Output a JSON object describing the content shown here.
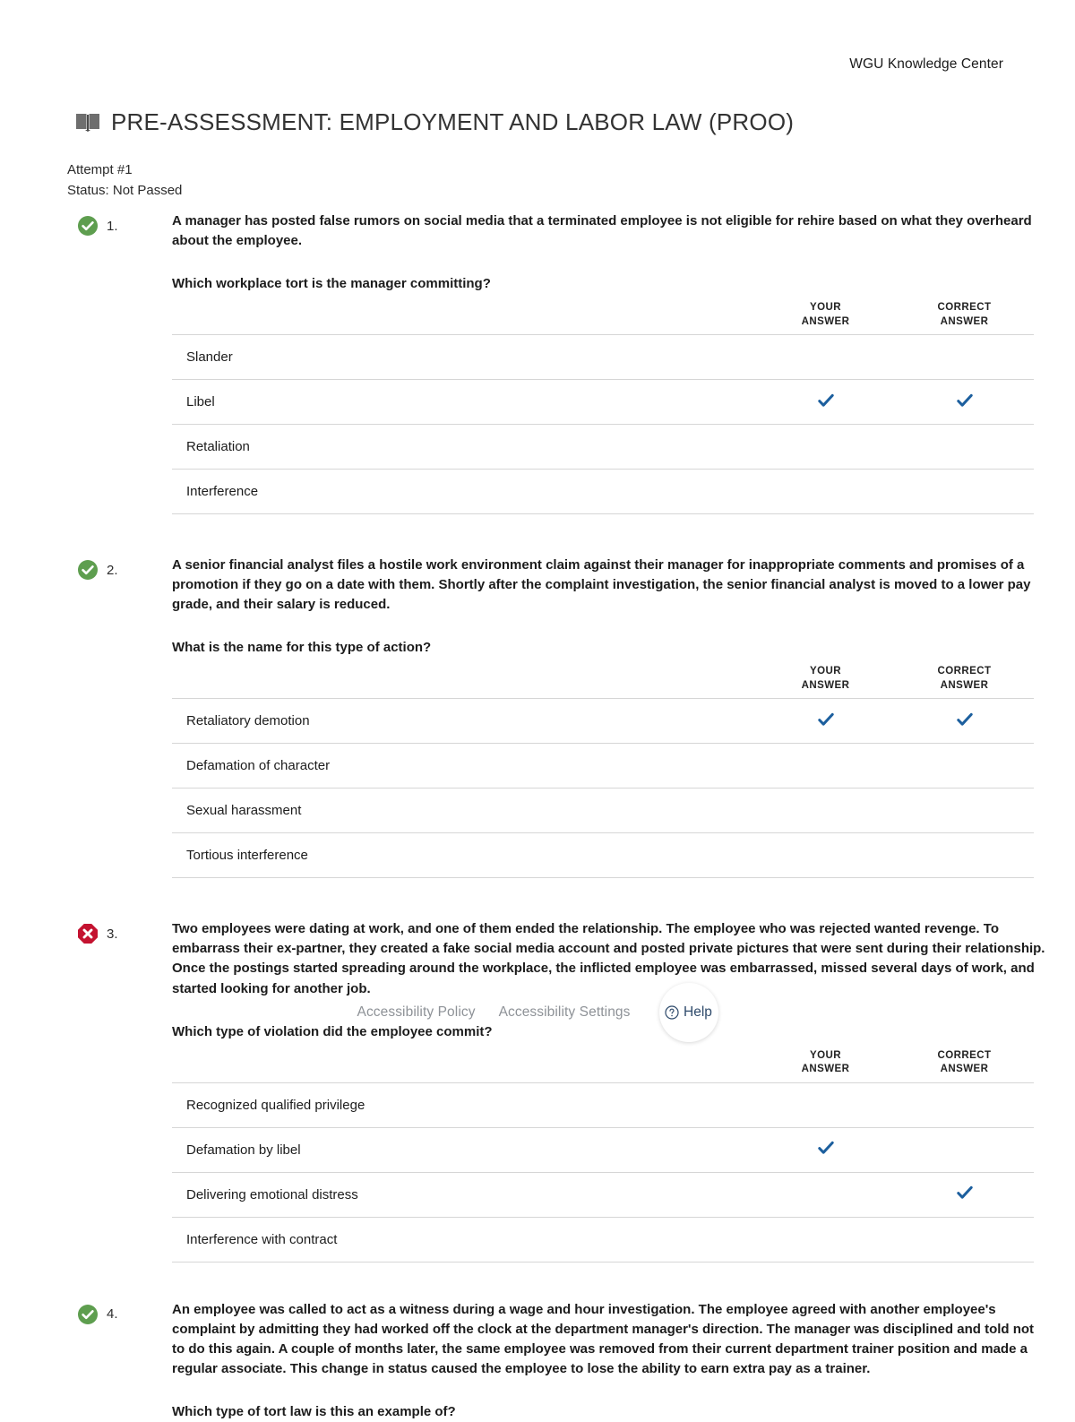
{
  "header": {
    "brand": "WGU Knowledge Center",
    "book_icon": "book-icon",
    "title": "PRE-ASSESSMENT: EMPLOYMENT AND LABOR LAW (PROO)"
  },
  "attempt": {
    "attempt_label": "Attempt #1",
    "status_label": "Status: Not Passed"
  },
  "table_headers": {
    "your_answer_line1": "YOUR",
    "your_answer_line2": "ANSWER",
    "correct_answer_line1": "CORRECT",
    "correct_answer_line2": "ANSWER"
  },
  "colors": {
    "correct_green": "#5e9e4f",
    "incorrect_red": "#c41230",
    "check_blue": "#1c5f9e",
    "divider": "#d6d6d6",
    "muted_text": "#8e9297",
    "help_text": "#2e4a6b"
  },
  "questions": [
    {
      "number": "1.",
      "status": "correct",
      "status_icon": "check-circle-icon",
      "stem": "A manager has posted false rumors on social media that a terminated employee is not eligible for rehire based on what they overheard about the employee.",
      "prompt": "Which workplace tort is the manager committing?",
      "options": [
        {
          "label": "Slander",
          "your_answer": false,
          "correct_answer": false
        },
        {
          "label": "Libel",
          "your_answer": true,
          "correct_answer": true
        },
        {
          "label": "Retaliation",
          "your_answer": false,
          "correct_answer": false
        },
        {
          "label": "Interference",
          "your_answer": false,
          "correct_answer": false
        }
      ]
    },
    {
      "number": "2.",
      "status": "correct",
      "status_icon": "check-circle-icon",
      "stem": "A senior financial analyst files a hostile work environment claim against their manager for inappropriate comments and promises of a promotion if they go on a date with them. Shortly after the complaint investigation, the senior financial analyst is moved to a lower pay grade, and their salary is reduced.",
      "prompt": "What is the name for this type of action?",
      "options": [
        {
          "label": "Retaliatory demotion",
          "your_answer": true,
          "correct_answer": true
        },
        {
          "label": "Defamation of character",
          "your_answer": false,
          "correct_answer": false
        },
        {
          "label": "Sexual harassment",
          "your_answer": false,
          "correct_answer": false
        },
        {
          "label": "Tortious interference",
          "your_answer": false,
          "correct_answer": false
        }
      ]
    },
    {
      "number": "3.",
      "status": "incorrect",
      "status_icon": "x-octagon-icon",
      "stem": "Two employees were dating at work, and one of them ended the relationship. The employee who was rejected wanted revenge. To embarrass their ex-partner, they created a fake social media account and posted private pictures that were sent during their relationship. Once the postings started spreading around the workplace, the inflicted employee was embarrassed, missed several days of work, and started looking for another job.",
      "prompt": "Which type of violation did the employee commit?",
      "options": [
        {
          "label": "Recognized qualified privilege",
          "your_answer": false,
          "correct_answer": false
        },
        {
          "label": "Defamation by libel",
          "your_answer": true,
          "correct_answer": false
        },
        {
          "label": "Delivering emotional distress",
          "your_answer": false,
          "correct_answer": true
        },
        {
          "label": "Interference with contract",
          "your_answer": false,
          "correct_answer": false
        }
      ]
    },
    {
      "number": "4.",
      "status": "correct",
      "status_icon": "check-circle-icon",
      "stem": "An employee was called to act as a witness during a wage and hour investigation. The employee agreed with another employee's complaint by admitting they had worked off the clock at the department manager's direction. The manager was disciplined and told not to do this again. A couple of months later, the same employee was removed from their current department trainer position and made a regular associate. This change in status caused the employee to lose the ability to earn extra pay as a trainer.",
      "prompt": "Which type of tort law is this an example of?",
      "options": []
    }
  ],
  "accessibility_bar": {
    "policy_link": "Accessibility Policy",
    "settings_link": "Accessibility Settings",
    "help_label": "Help",
    "help_icon": "question-circle-icon"
  }
}
